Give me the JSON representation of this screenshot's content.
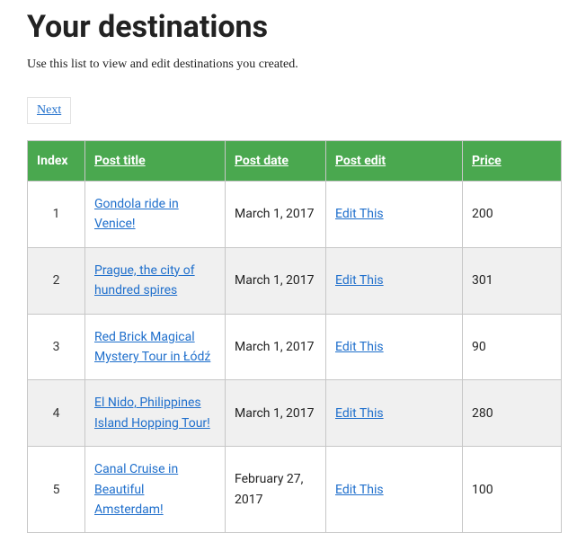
{
  "heading": "Your destinations",
  "subheading": "Use this list to view and edit destinations you created.",
  "pager": {
    "next_label": "Next"
  },
  "table": {
    "headers": {
      "index": "Index",
      "title": "Post title",
      "date": "Post date",
      "edit": "Post edit",
      "price": "Price"
    },
    "edit_label": "Edit This",
    "rows": [
      {
        "index": "1",
        "title": "Gondola ride in Venice!",
        "date": "March 1, 2017",
        "price": "200"
      },
      {
        "index": "2",
        "title": "Prague, the city of hundred spires",
        "date": "March 1, 2017",
        "price": "301"
      },
      {
        "index": "3",
        "title": "Red Brick Magical Mystery Tour in Łódź",
        "date": "March 1, 2017",
        "price": "90"
      },
      {
        "index": "4",
        "title": "El Nido, Philippines Island Hopping Tour!",
        "date": "March 1, 2017",
        "price": "280"
      },
      {
        "index": "5",
        "title": "Canal Cruise in Beautiful Amsterdam!",
        "date": "February 27, 2017",
        "price": "100"
      }
    ]
  }
}
